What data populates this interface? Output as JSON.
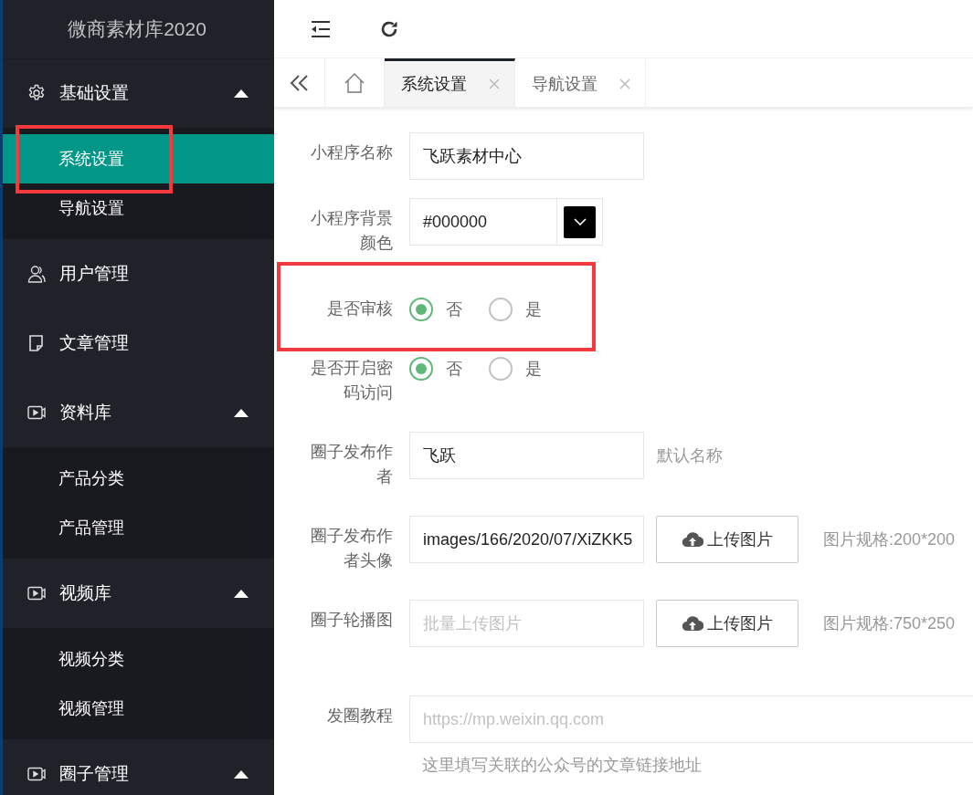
{
  "sidebar": {
    "title": "微商素材库2020",
    "groups": [
      {
        "label": "基础设置",
        "kind": "group",
        "expanded": true,
        "children": [
          {
            "label": "系统设置",
            "selected": true,
            "highlighted": true
          },
          {
            "label": "导航设置",
            "selected": false,
            "highlighted": false
          }
        ]
      },
      {
        "label": "用户管理",
        "kind": "link"
      },
      {
        "label": "文章管理",
        "kind": "link"
      },
      {
        "label": "资料库",
        "kind": "group",
        "expanded": true,
        "children": [
          {
            "label": "产品分类",
            "selected": false,
            "highlighted": false
          },
          {
            "label": "产品管理",
            "selected": false,
            "highlighted": false
          }
        ]
      },
      {
        "label": "视频库",
        "kind": "group",
        "expanded": true,
        "children": [
          {
            "label": "视频分类",
            "selected": false,
            "highlighted": false
          },
          {
            "label": "视频管理",
            "selected": false,
            "highlighted": false
          }
        ]
      },
      {
        "label": "圈子管理",
        "kind": "group",
        "expanded": true
      }
    ]
  },
  "tabs": [
    {
      "label": "系统设置",
      "selected": true
    },
    {
      "label": "导航设置",
      "selected": false
    }
  ],
  "form": [
    {
      "kind": "text",
      "label": "小程序名称",
      "value": "飞跃素材中心"
    },
    {
      "kind": "color",
      "label": "小程序背景颜色",
      "value": "#000000"
    },
    {
      "kind": "radio",
      "label": "是否审核",
      "highlighted": true,
      "options": [
        {
          "label": "否",
          "selected": true
        },
        {
          "label": "是",
          "selected": false
        }
      ]
    },
    {
      "kind": "radio",
      "label": "是否开启密码访问",
      "highlighted": false,
      "options": [
        {
          "label": "否",
          "selected": true
        },
        {
          "label": "是",
          "selected": false
        }
      ]
    },
    {
      "kind": "text",
      "label": "圈子发布作者",
      "value": "飞跃",
      "hint": "默认名称"
    },
    {
      "kind": "upload",
      "label": "圈子发布作者头像",
      "value": "images/166/2020/07/XiZKK5",
      "button": "上传图片",
      "hint": "图片规格:200*200"
    },
    {
      "kind": "upload",
      "label": "圈子轮播图",
      "placeholder": "批量上传图片",
      "button": "上传图片",
      "hint": "图片规格:750*250"
    },
    {
      "kind": "url",
      "label": "发圈教程",
      "placeholder": "https://mp.weixin.qq.com",
      "help": "这里填写关联的公众号的文章链接地址"
    }
  ]
}
